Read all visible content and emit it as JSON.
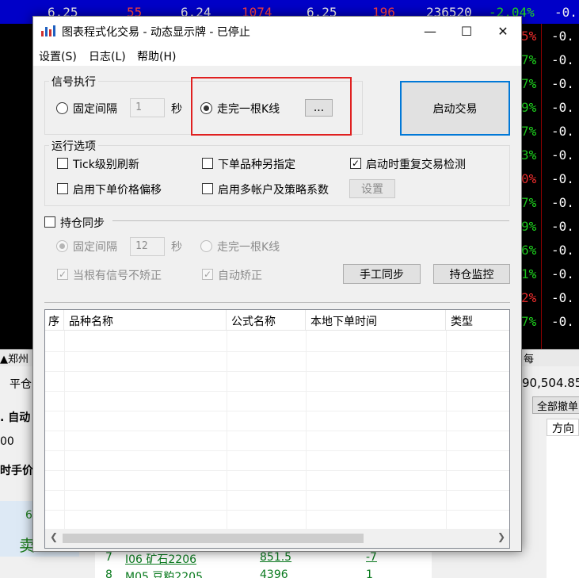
{
  "background_app": {
    "top_row": [
      "6.25",
      "55",
      "6.24",
      "1074",
      "6.25",
      "196",
      "236520",
      "-2.04%",
      "-0."
    ],
    "right_column": [
      {
        "pct": "5%",
        "val": "-0.",
        "color": "#ff3030"
      },
      {
        "pct": "7%",
        "val": "-0.",
        "color": "#20e020"
      },
      {
        "pct": "7%",
        "val": "-0.",
        "color": "#20e020"
      },
      {
        "pct": "9%",
        "val": "-0.",
        "color": "#20e020"
      },
      {
        "pct": "7%",
        "val": "-0.",
        "color": "#20e020"
      },
      {
        "pct": "3%",
        "val": "-0.",
        "color": "#20e020"
      },
      {
        "pct": "0%",
        "val": "-0.",
        "color": "#ff3030"
      },
      {
        "pct": "7%",
        "val": "-0.",
        "color": "#20e020"
      },
      {
        "pct": "9%",
        "val": "-0.",
        "color": "#20e020"
      },
      {
        "pct": "6%",
        "val": "-0.",
        "color": "#20e020"
      },
      {
        "pct": "1%",
        "val": "-0.",
        "color": "#20e020"
      },
      {
        "pct": "2%",
        "val": "-0.",
        "color": "#ff3030"
      },
      {
        "pct": "7%",
        "val": "-0.",
        "color": "#20e020"
      }
    ],
    "tab_left": "▲郑州",
    "tab_right": "每",
    "lower_left": [
      "平仓",
      ". 自动",
      "00",
      "时手价",
      "6",
      "卖"
    ],
    "balance": "90,504.85",
    "cancel_all": "全部撤单",
    "direction_header": "方向",
    "table_rows": [
      {
        "no": "7",
        "name": "I06 矿石2206",
        "price": "851.5",
        "qty": "-7"
      },
      {
        "no": "8",
        "name": "M05 豆粕2205",
        "price": "4396",
        "qty": "1"
      }
    ]
  },
  "dialog": {
    "title": "图表程式化交易 - 动态显示牌 - 已停止",
    "window_buttons": {
      "minimize": "—",
      "maximize": "☐",
      "close": "✕"
    },
    "menu": [
      "设置(S)",
      "日志(L)",
      "帮助(H)"
    ],
    "signal": {
      "group_label": "信号执行",
      "fixed_interval_label": "固定间隔",
      "interval_value": "1",
      "seconds_label": "秒",
      "kline_label": "走完一根K线",
      "more_button": "...",
      "fixed_selected": false,
      "kline_selected": true
    },
    "start_button": "启动交易",
    "options": {
      "group_label": "运行选项",
      "tick_refresh": {
        "label": "Tick级别刷新",
        "checked": false
      },
      "order_symbol": {
        "label": "下单品种另指定",
        "checked": false
      },
      "startup_check": {
        "label": "启动时重复交易检测",
        "checked": true
      },
      "price_offset": {
        "label": "启用下单价格偏移",
        "checked": false
      },
      "multi_account": {
        "label": "启用多帐户及策略系数",
        "checked": false
      },
      "settings_button": "设置"
    },
    "sync": {
      "label": "持仓同步",
      "checked": false,
      "fixed_interval_label": "固定间隔",
      "interval_value": "12",
      "seconds_label": "秒",
      "kline_label": "走完一根K线",
      "no_correct_label": "当根有信号不矫正",
      "auto_correct_label": "自动矫正",
      "manual_sync_button": "手工同步",
      "monitor_button": "持仓监控"
    },
    "table": {
      "columns": [
        "序",
        "品种名称",
        "公式名称",
        "本地下单时间",
        "类型"
      ]
    }
  }
}
